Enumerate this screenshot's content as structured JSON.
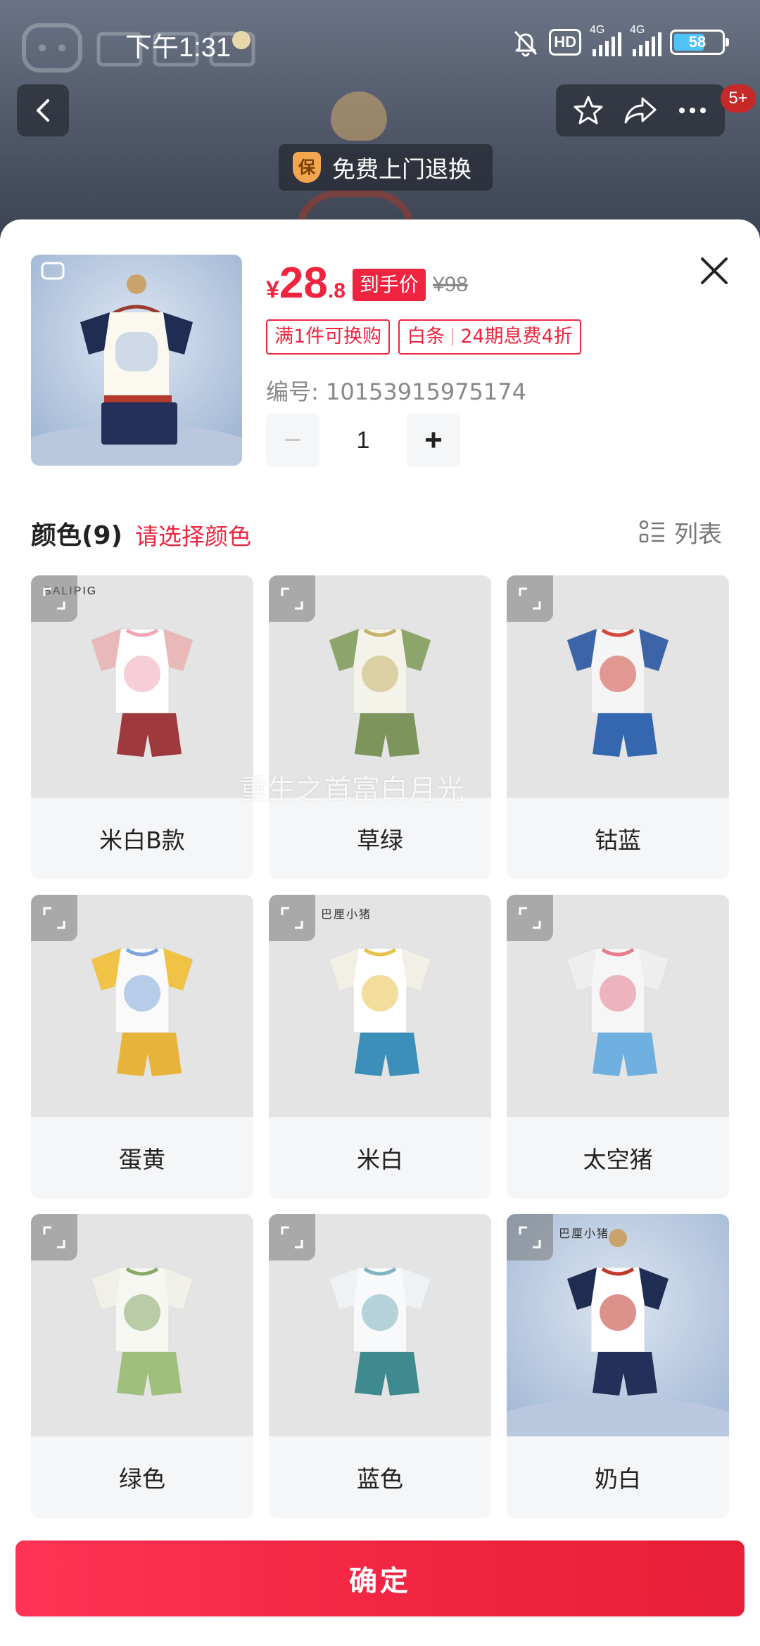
{
  "status_bar": {
    "time": "下午1:31",
    "hd_label": "HD",
    "sig1_label": "4G",
    "sig2_label": "4G",
    "battery": "58"
  },
  "header": {
    "cart_badge": "5+",
    "guarantee_icon_text": "保",
    "guarantee_text": "免费上门退换"
  },
  "product": {
    "currency": "¥",
    "price_int": "28",
    "price_dec": ".8",
    "price_tag": "到手价",
    "original_price": "¥98",
    "promos": [
      "满1件可换购",
      "白条",
      "24期息费4折"
    ],
    "sku_label": "编号: 10153915975174",
    "quantity": "1",
    "minus": "−",
    "plus": "+"
  },
  "color_section": {
    "title": "颜色(9)",
    "hint": "请选择颜色",
    "view_label": "列表",
    "options": [
      {
        "label": "米白B款",
        "brand": "BALIPIG",
        "shirt": "#ffffff",
        "sleeve": "#e9b8b8",
        "short": "#9e3a3d",
        "accent": "#f1a6b8"
      },
      {
        "label": "草绿",
        "brand": "",
        "shirt": "#f4f3ea",
        "sleeve": "#8da46a",
        "short": "#7d955c",
        "accent": "#c7b36a"
      },
      {
        "label": "钴蓝",
        "brand": "",
        "shirt": "#f5f5f5",
        "sleeve": "#3c64a8",
        "short": "#3567b1",
        "accent": "#d24a3f"
      },
      {
        "label": "蛋黄",
        "brand": "",
        "shirt": "#fafafa",
        "sleeve": "#f0c245",
        "short": "#e6b43a",
        "accent": "#7fa6d8"
      },
      {
        "label": "米白",
        "brand": "巴厘小猪",
        "shirt": "#ffffff",
        "sleeve": "#f2efe6",
        "short": "#3b8fb8",
        "accent": "#e7c14c"
      },
      {
        "label": "太空猪",
        "brand": "",
        "shirt": "#f6f6f6",
        "sleeve": "#eeeeee",
        "short": "#6fb0e0",
        "accent": "#e57c8f"
      },
      {
        "label": "绿色",
        "brand": "",
        "shirt": "#f7f7f2",
        "sleeve": "#f0f0e8",
        "short": "#9fbf7c",
        "accent": "#89a86a"
      },
      {
        "label": "蓝色",
        "brand": "",
        "shirt": "#f7f9fa",
        "sleeve": "#eef2f4",
        "short": "#3f8a8f",
        "accent": "#7fb3bf"
      },
      {
        "label": "奶白",
        "brand": "巴厘小猪",
        "shirt": "#ffffff",
        "sleeve": "#1f2d52",
        "short": "#24305a",
        "accent": "#c0392b"
      }
    ]
  },
  "watermark": "重生之首富白月光",
  "confirm_label": "确定"
}
